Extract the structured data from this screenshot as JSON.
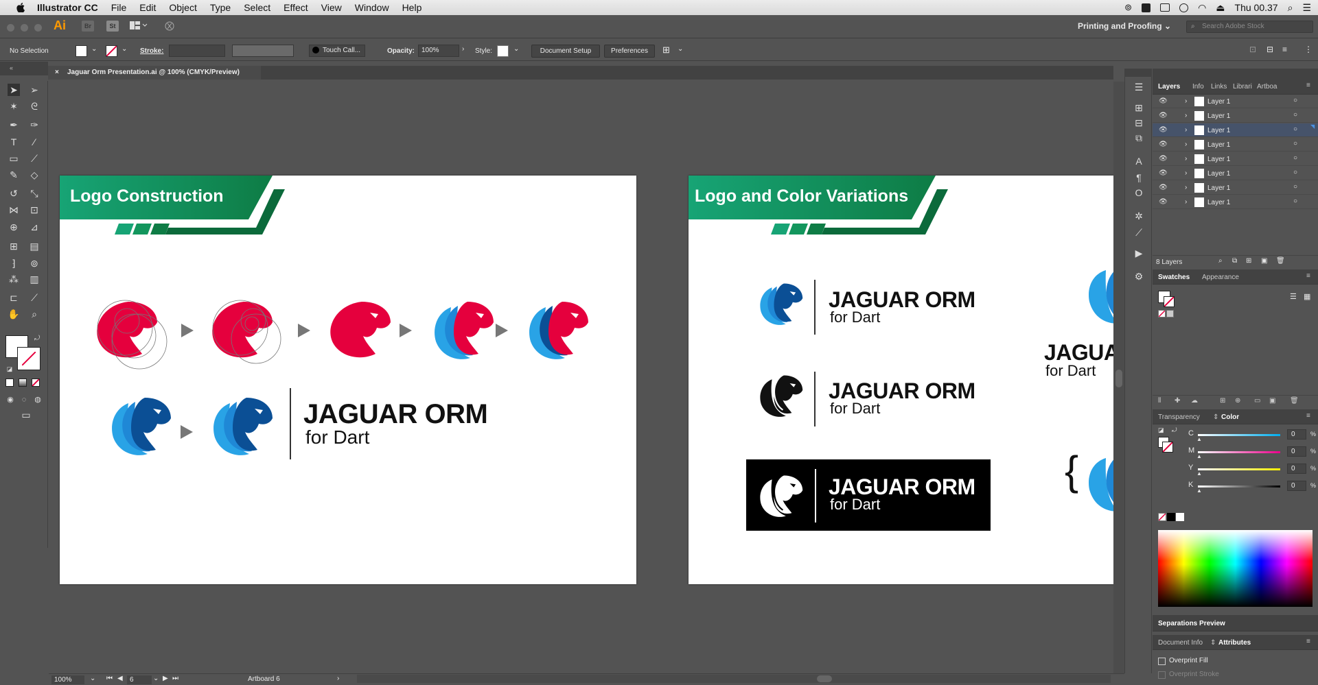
{
  "menubar": {
    "app": "Illustrator CC",
    "items": [
      "File",
      "Edit",
      "Object",
      "Type",
      "Select",
      "Effect",
      "View",
      "Window",
      "Help"
    ],
    "clock": "Thu 00.37"
  },
  "appbar": {
    "logo": "Ai",
    "badge_br": "Br",
    "badge_st": "St",
    "workspace": "Printing and Proofing",
    "stock_placeholder": "Search Adobe Stock"
  },
  "control": {
    "selection": "No Selection",
    "stroke_label": "Stroke:",
    "brush": "Touch Call...",
    "opacity_label": "Opacity:",
    "opacity": "100%",
    "style_label": "Style:",
    "doc_setup": "Document Setup",
    "preferences": "Preferences"
  },
  "document": {
    "tab_title": "Jaguar Orm Presentation.ai @ 100% (CMYK/Preview)"
  },
  "artboards": {
    "left": {
      "banner": "Logo Construction",
      "title": "JAGUAR ORM",
      "subtitle": "for Dart"
    },
    "right": {
      "banner": "Logo and Color Variations",
      "v1_title": "JAGUAR ORM",
      "v1_sub": "for Dart",
      "v2_title": "JAGUAR ORM",
      "v2_sub": "for Dart",
      "v3_title": "JAGUAR ORM",
      "v3_sub": "for Dart",
      "partial_title": "JAGUA",
      "partial_sub": "for Dart",
      "brace": "{"
    }
  },
  "colors": {
    "brand_green": "#1a9b62",
    "brand_dark_green": "#0e6e3e",
    "jaguar_red": "#e5003d",
    "jaguar_blue": "#1f88d6",
    "jaguar_navy": "#0b4f95"
  },
  "layers_panel": {
    "tabs": [
      "Layers",
      "Info",
      "Links",
      "Librari",
      "Artboa"
    ],
    "layers": [
      "Layer 1",
      "Layer 1",
      "Layer 1",
      "Layer 1",
      "Layer 1",
      "Layer 1",
      "Layer 1",
      "Layer 1"
    ],
    "selected_index": 2,
    "count": "8 Layers"
  },
  "swatches_panel": {
    "tabs": [
      "Swatches",
      "Appearance"
    ]
  },
  "color_panel": {
    "tabs": [
      "Transparency",
      "Color"
    ],
    "channels": [
      {
        "name": "C",
        "value": "0",
        "unit": "%"
      },
      {
        "name": "M",
        "value": "0",
        "unit": "%"
      },
      {
        "name": "Y",
        "value": "0",
        "unit": "%"
      },
      {
        "name": "K",
        "value": "0",
        "unit": "%"
      }
    ]
  },
  "separations": {
    "title": "Separations Preview"
  },
  "attributes_panel": {
    "tabs": [
      "Document Info",
      "Attributes"
    ],
    "overprint_fill": "Overprint Fill",
    "overprint_stroke": "Overprint Stroke"
  },
  "status": {
    "zoom": "100%",
    "artboard_num": "6",
    "artboard_label": "Artboard 6"
  }
}
